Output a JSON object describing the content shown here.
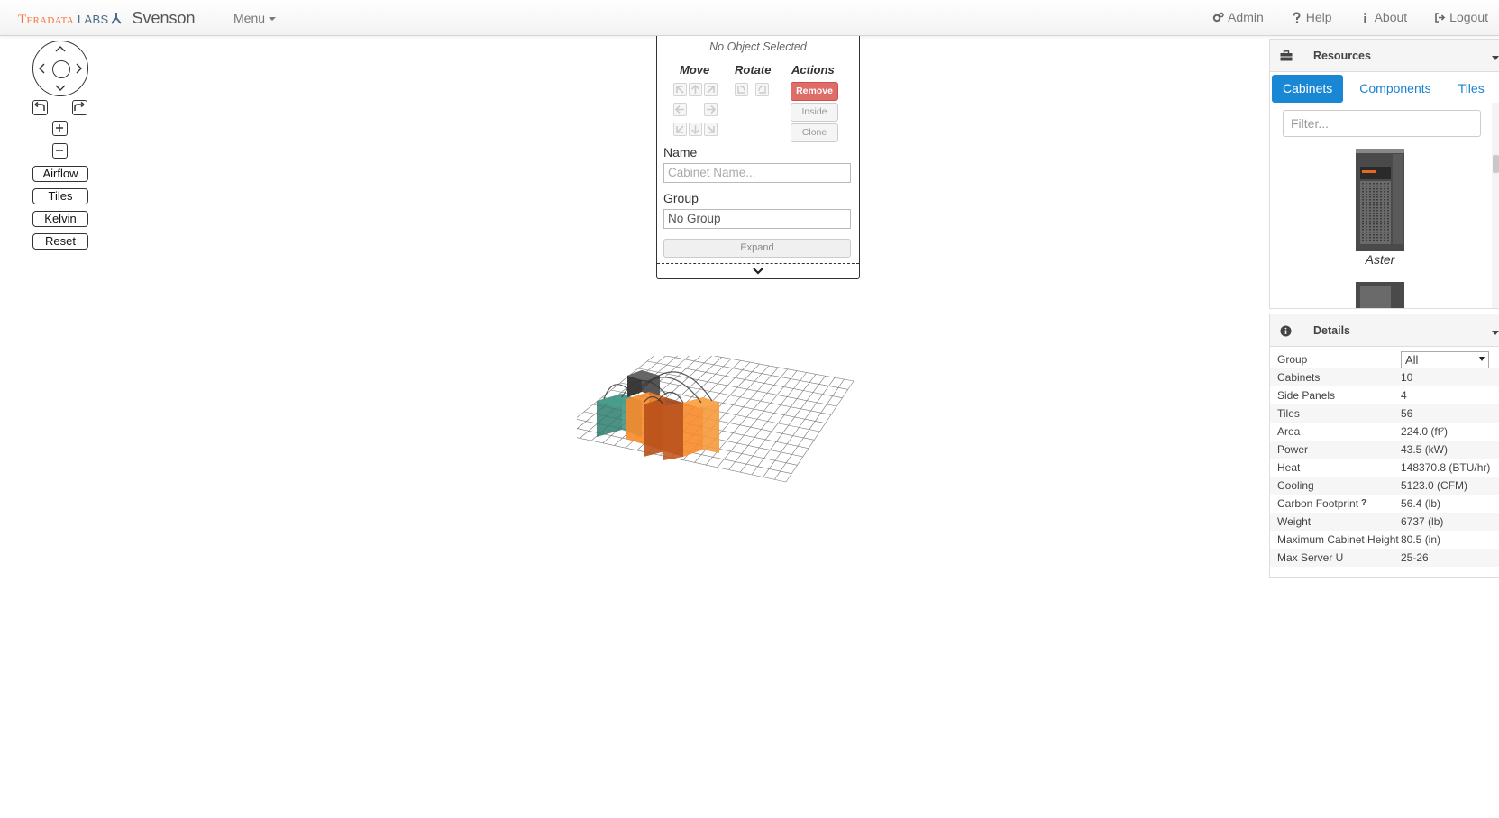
{
  "navbar": {
    "logo_text": "Teradata",
    "logo_labs": "LABS",
    "app_name": "Svenson",
    "menu_label": "Menu",
    "right_items": [
      {
        "label": "Admin",
        "icon": "cogs-icon"
      },
      {
        "label": "Help",
        "icon": "question-icon"
      },
      {
        "label": "About",
        "icon": "info-icon"
      },
      {
        "label": "Logout",
        "icon": "logout-icon"
      }
    ]
  },
  "controls": {
    "airflow": "Airflow",
    "tiles": "Tiles",
    "kelvin": "Kelvin",
    "reset": "Reset"
  },
  "object_panel": {
    "status": "No Object Selected",
    "move_header": "Move",
    "rotate_header": "Rotate",
    "actions_header": "Actions",
    "remove": "Remove",
    "inside": "Inside",
    "clone": "Clone",
    "name_label": "Name",
    "name_placeholder": "Cabinet Name...",
    "group_label": "Group",
    "group_value": "No Group",
    "expand": "Expand"
  },
  "resources": {
    "title": "Resources",
    "tabs": [
      "Cabinets",
      "Components",
      "Tiles"
    ],
    "active_tab": "Cabinets",
    "filter_placeholder": "Filter...",
    "items": [
      {
        "label": "Aster"
      }
    ]
  },
  "details": {
    "title": "Details",
    "group_label": "Group",
    "group_value": "All",
    "rows": [
      {
        "k": "Cabinets",
        "v": "10"
      },
      {
        "k": "Side Panels",
        "v": "4"
      },
      {
        "k": "Tiles",
        "v": "56"
      },
      {
        "k": "Area",
        "v": "224.0 (ft²)"
      },
      {
        "k": "Power",
        "v": "43.5 (kW)"
      },
      {
        "k": "Heat",
        "v": "148370.8 (BTU/hr)"
      },
      {
        "k": "Cooling",
        "v": "5123.0 (CFM)"
      },
      {
        "k": "Carbon Footprint",
        "v": "56.4 (lb)",
        "help": "?"
      },
      {
        "k": "Weight",
        "v": "6737 (lb)"
      },
      {
        "k": "Maximum Cabinet Height",
        "v": "80.5 (in)"
      },
      {
        "k": "Max Server U",
        "v": "25-26"
      }
    ]
  },
  "colors": {
    "accent": "#1a87d4",
    "logo_orange": "#f37440",
    "remove_red": "#d9534f",
    "cabinet_orange": "#f7892a",
    "cabinet_dark": "#b8501a",
    "cabinet_teal": "#2e7d6e"
  }
}
